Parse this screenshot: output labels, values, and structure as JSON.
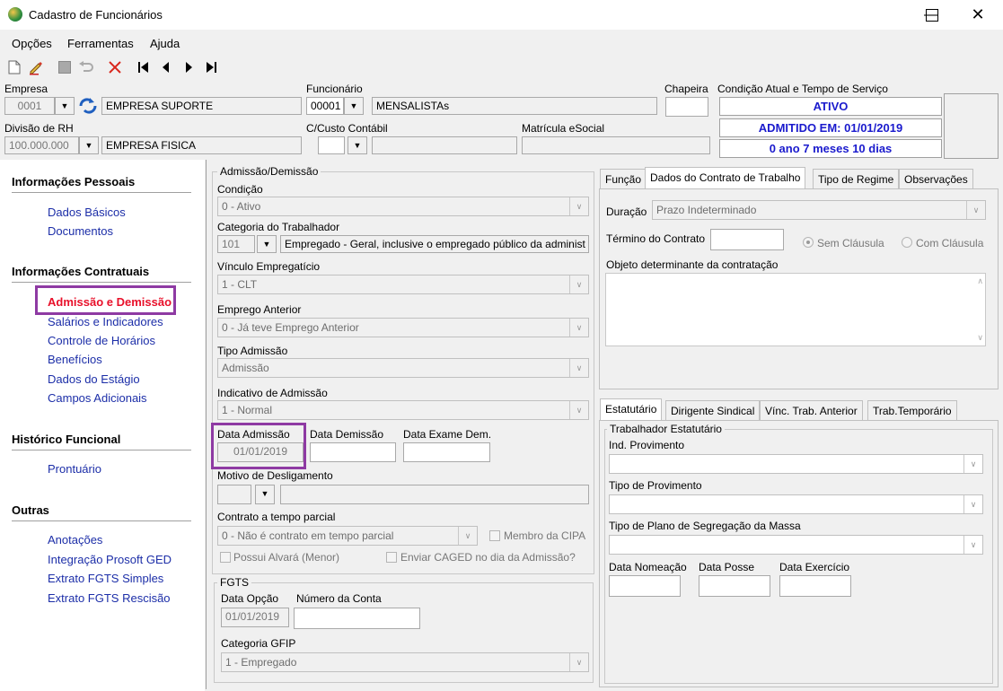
{
  "window": {
    "title": "Cadastro de Funcionários"
  },
  "menu": {
    "opcoes": "Opções",
    "ferramentas": "Ferramentas",
    "ajuda": "Ajuda"
  },
  "header": {
    "empresa_label": "Empresa",
    "empresa_code": "0001",
    "empresa_name": "EMPRESA SUPORTE",
    "funcionario_label": "Funcionário",
    "funcionario_code": "00001",
    "funcionario_name": "MENSALISTAs",
    "chapeira_label": "Chapeira",
    "condicao_label": "Condição Atual e Tempo de Serviço",
    "status_ativo": "ATIVO",
    "status_admitido": "ADMITIDO EM: 01/01/2019",
    "status_tempo": "0 ano 7 meses 10 dias",
    "divisao_label": "Divisão de RH",
    "divisao_code": "100.000.000",
    "divisao_name": "EMPRESA FISICA",
    "custo_label": "C/Custo Contábil",
    "matricula_label": "Matrícula eSocial"
  },
  "sidebar": {
    "pessoais": "Informações Pessoais",
    "dados_basicos": "Dados Básicos",
    "documentos": "Documentos",
    "contratuais": "Informações Contratuais",
    "admissao": "Admissão e Demissão",
    "salarios": "Salários e Indicadores",
    "controle": "Controle de Horários",
    "beneficios": "Benefícios",
    "estagio": "Dados do Estágio",
    "campos": "Campos Adicionais",
    "historico": "Histórico Funcional",
    "prontuario": "Prontuário",
    "outras": "Outras",
    "anotacoes": "Anotações",
    "ged": "Integração Prosoft GED",
    "fgts_simples": "Extrato FGTS Simples",
    "fgts_rescisao": "Extrato FGTS Rescisão"
  },
  "admissao": {
    "group_title": "Admissão/Demissão",
    "condicao_label": "Condição",
    "condicao_value": "0 - Ativo",
    "categoria_label": "Categoria do Trabalhador",
    "categoria_code": "101",
    "categoria_desc": "Empregado - Geral, inclusive o empregado público da administ",
    "vinculo_label": "Vínculo Empregatício",
    "vinculo_value": "1 - CLT",
    "emprego_label": "Emprego Anterior",
    "emprego_value": "0 - Já teve Emprego Anterior",
    "tipo_label": "Tipo Admissão",
    "tipo_value": "Admissão",
    "indicativo_label": "Indicativo de Admissão",
    "indicativo_value": "1 - Normal",
    "data_adm_label": "Data Admissão",
    "data_adm_value": "01/01/2019",
    "data_dem_label": "Data Demissão",
    "data_exame_label": "Data Exame Dem.",
    "motivo_label": "Motivo de Desligamento",
    "contrato_label": "Contrato a tempo parcial",
    "contrato_value": "0 - Não é contrato em tempo parcial",
    "cipa_label": "Membro da CIPA",
    "alvara_label": "Possui Alvará (Menor)",
    "caged_label": "Enviar CAGED no dia da Admissão?"
  },
  "fgts": {
    "group_title": "FGTS",
    "data_opcao_label": "Data Opção",
    "data_opcao_value": "01/01/2019",
    "conta_label": "Número da Conta",
    "gfip_label": "Categoria GFIP",
    "gfip_value": "1 - Empregado"
  },
  "tabs_top": {
    "funcao": "Função",
    "dados": "Dados do Contrato de Trabalho",
    "regime": "Tipo de Regime",
    "observacoes": "Observações",
    "duracao_label": "Duração",
    "duracao_value": "Prazo Indeterminado",
    "termino_label": "Término do Contrato",
    "sem_clausula": "Sem Cláusula",
    "com_clausula": "Com Cláusula",
    "objeto_label": "Objeto determinante da contratação"
  },
  "tabs_bottom": {
    "estatutario": "Estatutário",
    "dirigente": "Dirigente Sindical",
    "vinc": "Vínc. Trab. Anterior",
    "temporario": "Trab.Temporário",
    "group_title": "Trabalhador Estatutário",
    "ind_label": "Ind. Provimento",
    "tipo_prov_label": "Tipo de Provimento",
    "plano_label": "Tipo de Plano de Segregação da Massa",
    "nomeacao_label": "Data Nomeação",
    "posse_label": "Data Posse",
    "exercicio_label": "Data Exercício"
  },
  "colors": {
    "link": "#1c2ea8",
    "highlight": "#8e3aa3",
    "active_link": "#e8102a",
    "status_text": "#1a1acd"
  }
}
